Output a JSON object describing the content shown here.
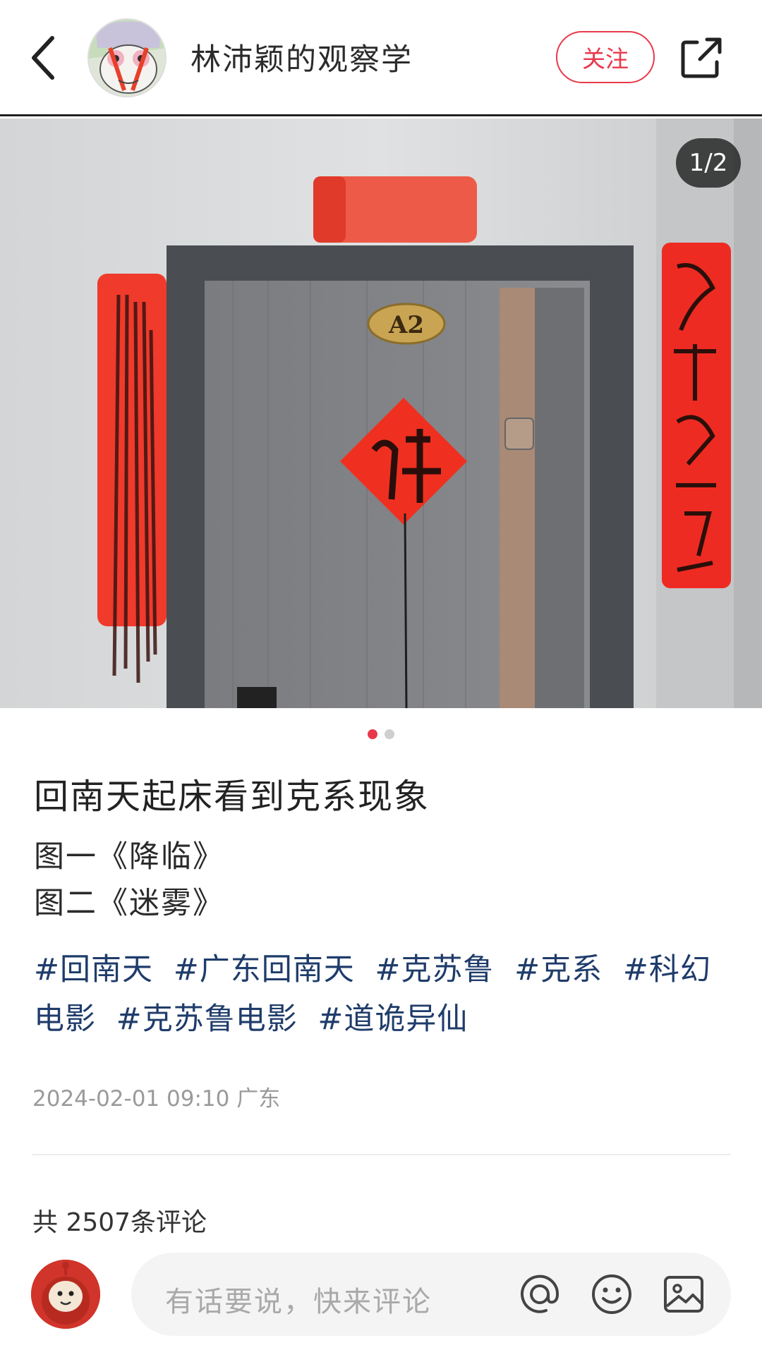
{
  "header": {
    "author_name": "林沛颖的观察学",
    "follow_label": "关注"
  },
  "gallery": {
    "counter": "1/2",
    "page_count": 2,
    "active_index": 0,
    "door_plate": "A2"
  },
  "post": {
    "title": "回南天起床看到克系现象",
    "lines": [
      "图一《降临》",
      "图二《迷雾》"
    ],
    "tags": [
      "#回南天",
      "#广东回南天",
      "#克苏鲁",
      "#克系",
      "#科幻电影",
      "#克苏鲁电影",
      "#道诡异仙"
    ],
    "meta": "2024-02-01 09:10 广东"
  },
  "comments": {
    "count_text": "共 2507条评论",
    "placeholder": "有话要说，快来评论"
  },
  "colors": {
    "accent": "#e8394a",
    "tag": "#1f3c6b",
    "couplet_red": "#e8281f"
  },
  "icons": [
    "back-icon",
    "share-icon",
    "at-icon",
    "emoji-icon",
    "image-icon"
  ]
}
